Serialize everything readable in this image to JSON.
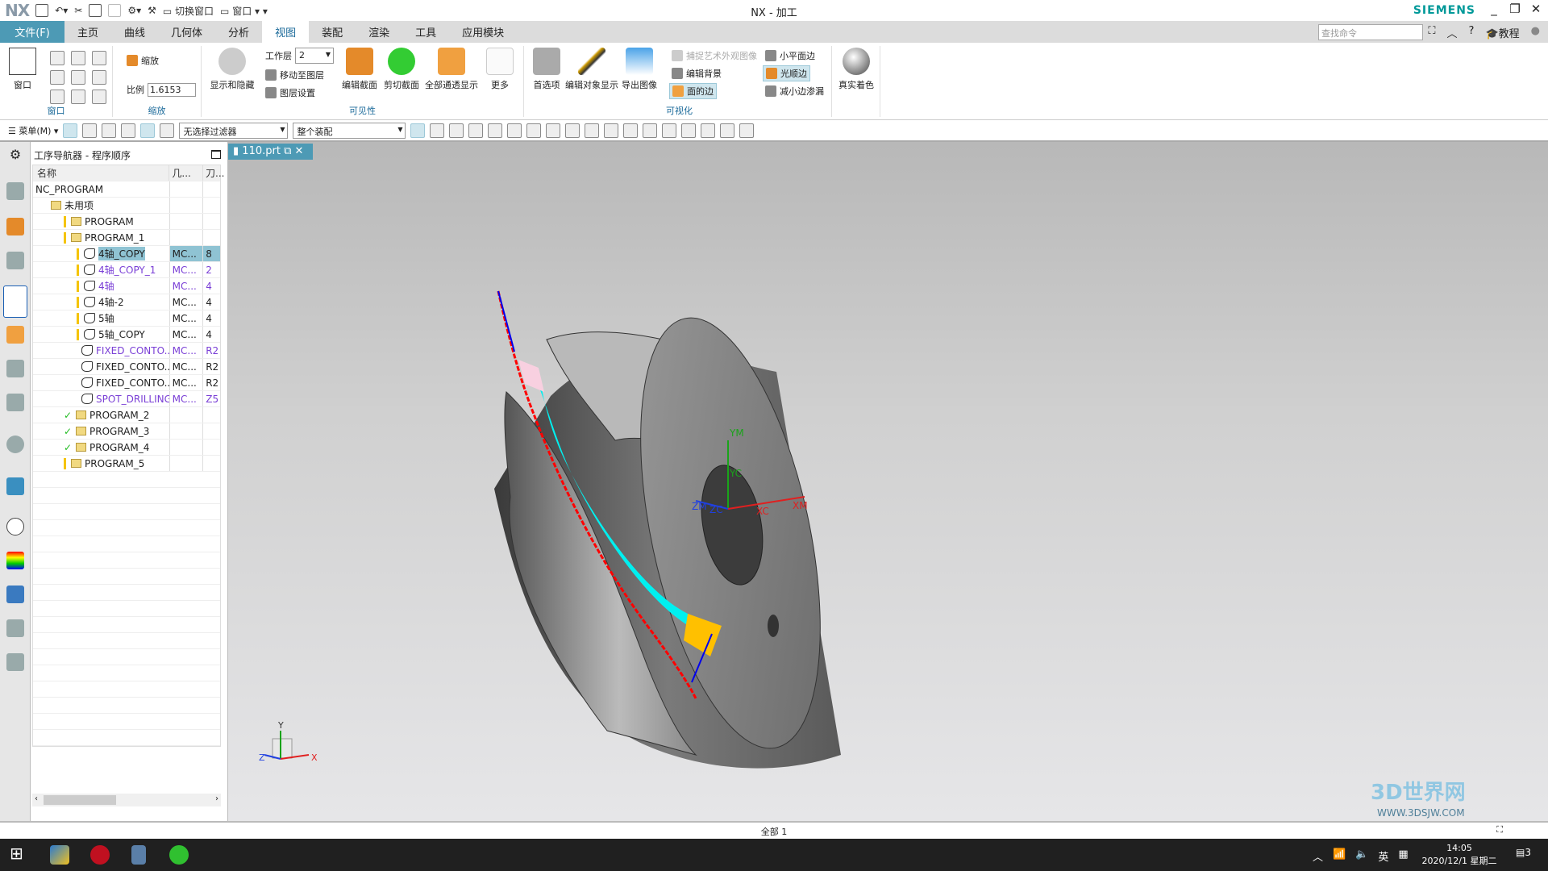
{
  "titlebar": {
    "logo": "NX",
    "title": "NX - 加工",
    "brand": "SIEMENS",
    "switch_window": "切换窗口",
    "window": "窗口",
    "minimize": "_",
    "restore": "❐",
    "close": "✕"
  },
  "tabs": [
    {
      "label": "文件(F)"
    },
    {
      "label": "主页"
    },
    {
      "label": "曲线"
    },
    {
      "label": "几何体"
    },
    {
      "label": "分析"
    },
    {
      "label": "视图",
      "active": true
    },
    {
      "label": "装配"
    },
    {
      "label": "渲染"
    },
    {
      "label": "工具"
    },
    {
      "label": "应用模块"
    }
  ],
  "search": {
    "placeholder": "查找命令"
  },
  "help": {
    "tutorial": "教程"
  },
  "ribbon": {
    "window_group": {
      "label": "窗口",
      "window_btn": "窗口"
    },
    "zoom_group": {
      "label": "缩放",
      "zoom": "缩放",
      "scale_label": "比例",
      "scale_value": "1.6153"
    },
    "visibility_group": {
      "label": "可见性",
      "show_hide": "显示和隐藏",
      "work_layer_label": "工作层",
      "work_layer_value": "2",
      "move_to_layer": "移动至图层",
      "layer_settings": "图层设置",
      "edit_section": "编辑截面",
      "clip_section": "剪切截面",
      "show_all_transparent": "全部通透显示",
      "more": "更多"
    },
    "visualization_group": {
      "label": "可视化",
      "preferences": "首选项",
      "edit_object_display": "编辑对象显示",
      "export_image": "导出图像",
      "capture_studio_image": "捕捉艺术外观图像",
      "edit_background": "编辑背景",
      "face_edges": "面的边",
      "small_face_edges": "小平面边",
      "smooth_edges": "光顺边",
      "reduce_edge_leak": "减小边渗漏"
    },
    "true_shading": "真实着色"
  },
  "cmdbar": {
    "menu": "菜单(M)",
    "selection_filter": "无选择过滤器",
    "scope": "整个装配"
  },
  "navigator": {
    "title": "工序导航器 - 程序顺序",
    "columns": [
      "名称",
      "几...",
      "刀..."
    ],
    "rows": [
      {
        "name": "NC_PROGRAM",
        "geom": "",
        "tool": "",
        "level": 0,
        "type": "root"
      },
      {
        "name": "未用项",
        "geom": "",
        "tool": "",
        "level": 1,
        "type": "folder"
      },
      {
        "name": "PROGRAM",
        "geom": "",
        "tool": "",
        "level": 2,
        "type": "folder",
        "mark": "bar"
      },
      {
        "name": "PROGRAM_1",
        "geom": "",
        "tool": "",
        "level": 2,
        "type": "folder",
        "mark": "bar",
        "expanded": true
      },
      {
        "name": "4轴_COPY",
        "geom": "MC...",
        "tool": "8",
        "level": 3,
        "type": "op",
        "selected": true
      },
      {
        "name": "4轴_COPY_1",
        "geom": "MC...",
        "tool": "2",
        "level": 3,
        "type": "op",
        "purple": true
      },
      {
        "name": "4轴",
        "geom": "MC...",
        "tool": "4",
        "level": 3,
        "type": "op",
        "purple": true
      },
      {
        "name": "4轴-2",
        "geom": "MC...",
        "tool": "4",
        "level": 3,
        "type": "op"
      },
      {
        "name": "5轴",
        "geom": "MC...",
        "tool": "4",
        "level": 3,
        "type": "op"
      },
      {
        "name": "5轴_COPY",
        "geom": "MC...",
        "tool": "4",
        "level": 3,
        "type": "op"
      },
      {
        "name": "FIXED_CONTO...",
        "geom": "MC...",
        "tool": "R2",
        "level": 3,
        "type": "op",
        "purple": true
      },
      {
        "name": "FIXED_CONTO...",
        "geom": "MC...",
        "tool": "R2",
        "level": 3,
        "type": "op"
      },
      {
        "name": "FIXED_CONTO...",
        "geom": "MC...",
        "tool": "R2",
        "level": 3,
        "type": "op"
      },
      {
        "name": "SPOT_DRILLING",
        "geom": "MC...",
        "tool": "Z5",
        "level": 3,
        "type": "op",
        "purple": true
      },
      {
        "name": "PROGRAM_2",
        "geom": "",
        "tool": "",
        "level": 2,
        "type": "folder",
        "mark": "check"
      },
      {
        "name": "PROGRAM_3",
        "geom": "",
        "tool": "",
        "level": 2,
        "type": "folder",
        "mark": "check"
      },
      {
        "name": "PROGRAM_4",
        "geom": "",
        "tool": "",
        "level": 2,
        "type": "folder",
        "mark": "check"
      },
      {
        "name": "PROGRAM_5",
        "geom": "",
        "tool": "",
        "level": 2,
        "type": "folder",
        "mark": "bar"
      }
    ]
  },
  "viewport": {
    "tab": "110.prt",
    "axes": {
      "xm": "XM",
      "ym": "YM",
      "zm": "ZM",
      "xc": "XC",
      "yc": "YC",
      "zc": "ZC",
      "x": "X",
      "y": "Y",
      "z": "Z"
    }
  },
  "status": {
    "text": "全部 1"
  },
  "taskbar": {
    "time": "14:05",
    "date": "2020/12/1 星期二",
    "ime": "英",
    "notifications": "3"
  },
  "watermark": {
    "text": "3D世界网",
    "url": "WWW.3DSJW.COM"
  },
  "colors": {
    "accent": "#4d9ab5",
    "brand": "#009999",
    "toolpath_cyan": "#00f0f0",
    "toolpath_red": "#ff0000",
    "toolpath_yellow": "#ffc000",
    "highlight": "#8fc3d3",
    "purple_text": "#7a3fd6"
  }
}
